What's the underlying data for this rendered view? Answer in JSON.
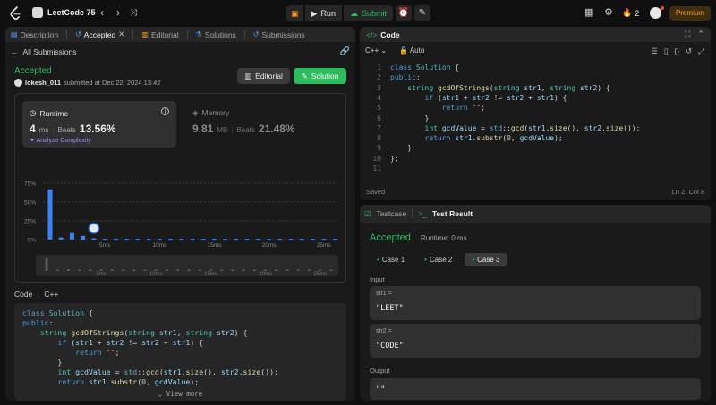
{
  "topbar": {
    "study_plan": "LeetCode 75",
    "run": "Run",
    "submit": "Submit",
    "streak": "2",
    "premium": "Premium",
    "colors": {
      "accent_green": "#2cbb5d",
      "premium_orange": "#ffa116"
    }
  },
  "left": {
    "tabs": [
      {
        "label": "Description",
        "icon": "description-icon"
      },
      {
        "label": "Accepted",
        "icon": "history-icon"
      },
      {
        "label": "Editorial",
        "icon": "book-icon"
      },
      {
        "label": "Solutions",
        "icon": "flask-icon"
      },
      {
        "label": "Submissions",
        "icon": "history-icon"
      }
    ],
    "back": "All Submissions",
    "status": "Accepted",
    "user": "lokesh_011",
    "submitted_text": "submitted at Dec 22, 2024 13:42",
    "editorial_btn": "Editorial",
    "solution_btn": "Solution",
    "runtime": {
      "label": "Runtime",
      "value": "4",
      "unit": "ms",
      "beats_label": "Beats",
      "beats": "13.56%",
      "analyze": "Analyze Complexity"
    },
    "memory": {
      "label": "Memory",
      "value": "9.81",
      "unit": "MB",
      "beats_label": "Beats",
      "beats": "21.48%"
    },
    "code_label": "Code",
    "code_lang": "C++",
    "view_more": "View more"
  },
  "chart_data": {
    "type": "bar",
    "x_ticks": [
      "5ms",
      "10ms",
      "15ms",
      "20ms",
      "25ms"
    ],
    "y_ticks": [
      "75%",
      "50%",
      "25%",
      "0%"
    ],
    "ylim": [
      0,
      75
    ],
    "x": [
      0,
      1,
      2,
      3,
      4,
      5,
      6,
      7,
      8,
      9,
      10,
      11,
      12,
      13,
      14,
      15,
      16,
      17,
      18,
      19,
      20,
      21,
      22,
      23,
      24,
      25,
      26
    ],
    "values": [
      67,
      3,
      9,
      5,
      2,
      1,
      1,
      1,
      1,
      1,
      1,
      1,
      1,
      1,
      1,
      1,
      1,
      1,
      1,
      1,
      1,
      1,
      1,
      1,
      1,
      1,
      1
    ],
    "highlight_index": 4
  },
  "slider_ticks": [
    "5ms",
    "10ms",
    "15ms",
    "20ms",
    "25ms"
  ],
  "code_panel": {
    "title": "Code",
    "language": "C++",
    "mode": "Auto",
    "saved": "Saved",
    "cursor": "Ln 2, Col 8"
  },
  "code_lines": [
    "class Solution {",
    "public:",
    "    string gcdOfStrings(string str1, string str2) {",
    "        if (str1 + str2 != str2 + str1) {",
    "            return \"\";",
    "        }",
    "        int gcdValue = std::gcd(str1.size(), str2.size());",
    "        return str1.substr(0, gcdValue);",
    "    }",
    "};",
    ""
  ],
  "result": {
    "testcase_tab": "Testcase",
    "result_tab": "Test Result",
    "status": "Accepted",
    "runtime": "Runtime: 0 ms",
    "cases": [
      "Case 1",
      "Case 2",
      "Case 3"
    ],
    "input_label": "Input",
    "inputs": [
      {
        "name": "str1 =",
        "value": "\"LEET\""
      },
      {
        "name": "str2 =",
        "value": "\"CODE\""
      }
    ],
    "output_label": "Output",
    "output": "\"\""
  }
}
